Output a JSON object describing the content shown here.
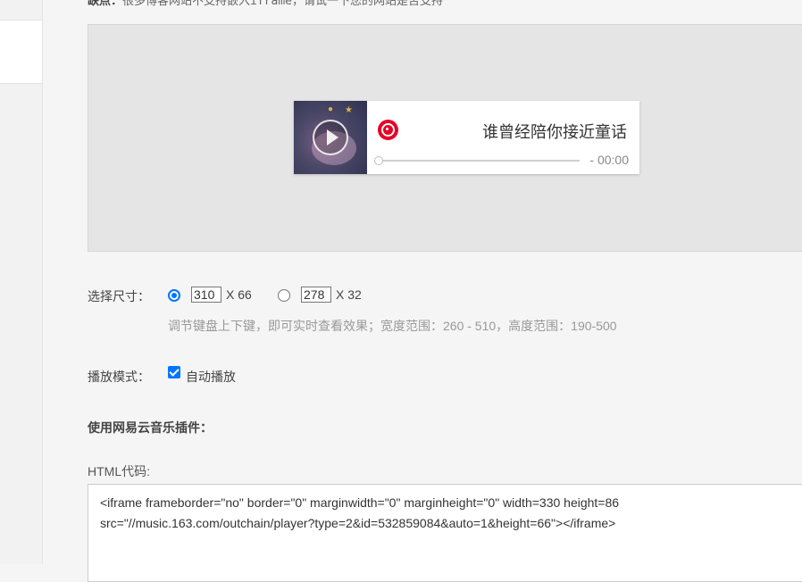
{
  "notice": {
    "label": "缺点：",
    "text": "很多博客网站不支持嵌入iframe，请试一下您的网站是否支持"
  },
  "player": {
    "song_title": "谁曾经陪你接近童话",
    "time": "- 00:00",
    "play_icon": "play-icon",
    "logo_icon": "netease-music-logo"
  },
  "size": {
    "label": "选择尺寸：",
    "option1": {
      "width": "310",
      "height_text": "X 66",
      "selected": true
    },
    "option2": {
      "width": "278",
      "height_text": "X 32",
      "selected": false
    },
    "hint": "调节键盘上下键，即可实时查看效果；宽度范围：260 - 510，高度范围：190-500"
  },
  "mode": {
    "label": "播放模式：",
    "autoplay_label": "自动播放",
    "autoplay_checked": true
  },
  "plugin": {
    "heading": "使用网易云音乐插件：",
    "code_label": "HTML代码:",
    "code": "<iframe frameborder=\"no\" border=\"0\" marginwidth=\"0\" marginheight=\"0\" width=330 height=86\nsrc=\"//music.163.com/outchain/player?type=2&id=532859084&auto=1&height=66\"></iframe>"
  },
  "colors": {
    "accent": "#0075ff",
    "netease_red": "#e60026",
    "preview_bg": "#e5e5e5"
  }
}
